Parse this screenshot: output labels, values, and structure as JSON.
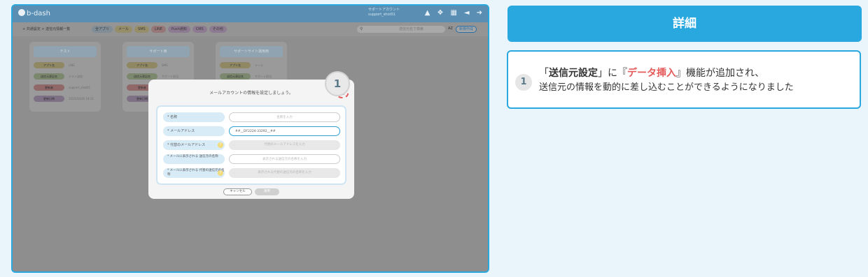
{
  "app": {
    "logo": "b-dash",
    "user_line1": "サポートアカウント",
    "user_line2": "support_shot01",
    "top_icons": [
      "bell-icon",
      "wrench-icon",
      "grid-icon",
      "megaphone-icon",
      "logout-icon"
    ]
  },
  "subbar": {
    "breadcrumb": "+ 共通設定 > 送信元情報一覧",
    "tabs": [
      {
        "label": "全アプリ",
        "color": "#cfe4f3"
      },
      {
        "label": "メール",
        "color": "#f2e5a8"
      },
      {
        "label": "SMS",
        "color": "#f2e5a8"
      },
      {
        "label": "LINE",
        "color": "#f3c0c0"
      },
      {
        "label": "Push通知",
        "color": "#e3c8ea"
      },
      {
        "label": "CMS",
        "color": "#e3c8ea"
      },
      {
        "label": "その他",
        "color": "#e3c8ea"
      }
    ],
    "search_placeholder": "送信元名で検索",
    "sort": "AZ",
    "new_button": "新規作成"
  },
  "cards": [
    {
      "title": "テスト",
      "rows": [
        {
          "label": "アプリ名",
          "value": "LINE",
          "color": "#e8dca0"
        },
        {
          "label": "送信元表記名",
          "value": "テスト送信",
          "color": "#c8dcb0"
        },
        {
          "label": "更新者",
          "value": "support_shot01",
          "color": "#e8a8a8"
        },
        {
          "label": "更新日時",
          "value": "2023/10/26 19:11",
          "color": "#cbb7d8"
        }
      ]
    },
    {
      "title": "サポート用",
      "rows": [
        {
          "label": "アプリ名",
          "value": "SMS",
          "color": "#e8dca0"
        },
        {
          "label": "送信元表記名",
          "value": "サポート担当",
          "color": "#c8dcb0"
        },
        {
          "label": "更新者",
          "value": "",
          "color": "#e8a8a8"
        },
        {
          "label": "更新日時",
          "value": "",
          "color": "#cbb7d8"
        }
      ]
    },
    {
      "title": "サポートサイト運用用",
      "rows": [
        {
          "label": "アプリ名",
          "value": "メール",
          "color": "#e8dca0"
        },
        {
          "label": "送信元表記名",
          "value": "サポート担当",
          "color": "#c8dcb0"
        },
        {
          "label": "更新者",
          "value": "",
          "color": "#e8a8a8"
        },
        {
          "label": "更新日時",
          "value": "",
          "color": "#cbb7d8"
        }
      ]
    }
  ],
  "modal": {
    "title": "メールアカウントの情報を設定しましょう。",
    "fields": [
      {
        "label": "* 名称",
        "value": "名称を入力",
        "kind": "white",
        "help": false
      },
      {
        "label": "* メールアドレス",
        "value": "##__DF2224-33292__##",
        "kind": "active",
        "help": false
      },
      {
        "label": "* 代替のメールアドレス",
        "value": "代替のメールアドレスを入力",
        "kind": "gray",
        "help": true
      },
      {
        "label": "* メールに表示される 送信元の名称",
        "value": "表示される送信元の名称を入力",
        "kind": "white",
        "help": false
      },
      {
        "label": "* メールに表示される 代替の送信元の名称",
        "value": "表示される代替の送信元の名称を入力",
        "kind": "gray",
        "help": true
      }
    ],
    "cancel": "キャンセル",
    "apply": "適用",
    "badge": "1"
  },
  "detail": {
    "header": "詳細",
    "number": "1",
    "line1_pre": "「",
    "line1_bold": "送信元設定",
    "line1_mid": "」に『",
    "line1_red": "データ挿入",
    "line1_post": "』機能が追加され、",
    "line2": "送信元の情報を動的に差し込むことができるようになりました"
  }
}
